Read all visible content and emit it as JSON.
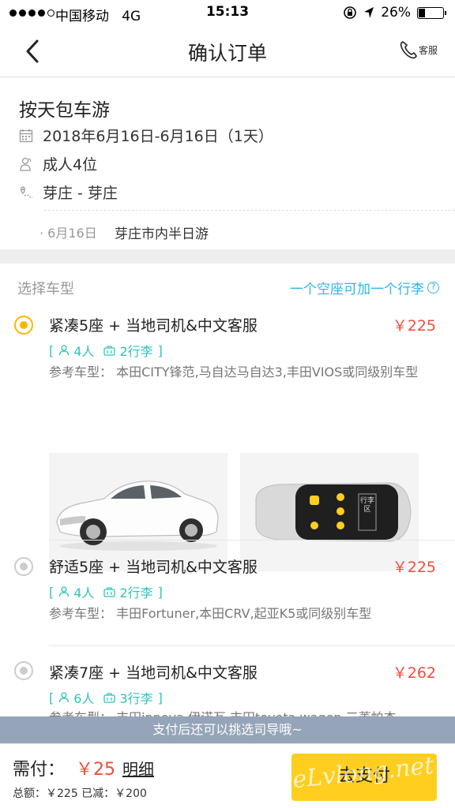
{
  "status_bar": {
    "carrier": "中国移动",
    "network": "4G",
    "time": "15:13",
    "battery": "26%",
    "battery_level": 0.26
  },
  "nav": {
    "title": "确认订单",
    "service_label": "客服"
  },
  "trip": {
    "name": "按天包车游",
    "date_range": "2018年6月16日-6月16日（1天）",
    "passengers": "成人4位",
    "route": "芽庄 - 芽庄",
    "itinerary": [
      {
        "date": "6月16日",
        "plan": "芽庄市内半日游"
      }
    ]
  },
  "vehicles": {
    "section_title": "选择车型",
    "hint": "一个空座可加一个行李",
    "hint_icon": "?",
    "trunk_label": "行李区",
    "options": [
      {
        "name": "紧凑5座 + 当地司机&中文客服",
        "price": "￥225",
        "people": "4人",
        "luggage": "2行李",
        "ref": "参考车型： 本田CITY锋范,马自达马自达3,丰田VIOS或同级别车型",
        "selected": true
      },
      {
        "name": "舒适5座 + 当地司机&中文客服",
        "price": "￥225",
        "people": "4人",
        "luggage": "2行李",
        "ref": "参考车型： 丰田Fortuner,本田CRV,起亚K5或同级别车型",
        "selected": false
      },
      {
        "name": "紧凑7座 + 当地司机&中文客服",
        "price": "￥262",
        "people": "6人",
        "luggage": "3行李",
        "ref": "参考车型： 丰田innova,伊诺瓦,丰田toyota wagon,三菱帕杰",
        "selected": false
      }
    ]
  },
  "tip": "支付后还可以挑选司导哦~",
  "bottom": {
    "need_label": "需付：",
    "amount": "￥25",
    "detail_label": "明细",
    "summary": "总额：￥225  已减：￥200",
    "pay_label": "去支付"
  },
  "watermark": "eLvlong.net",
  "colors": {
    "accent": "#ffb400",
    "price": "#f24c3d",
    "teal": "#2ec5b8",
    "link": "#2eb5e6",
    "pay": "#ffce1f"
  }
}
